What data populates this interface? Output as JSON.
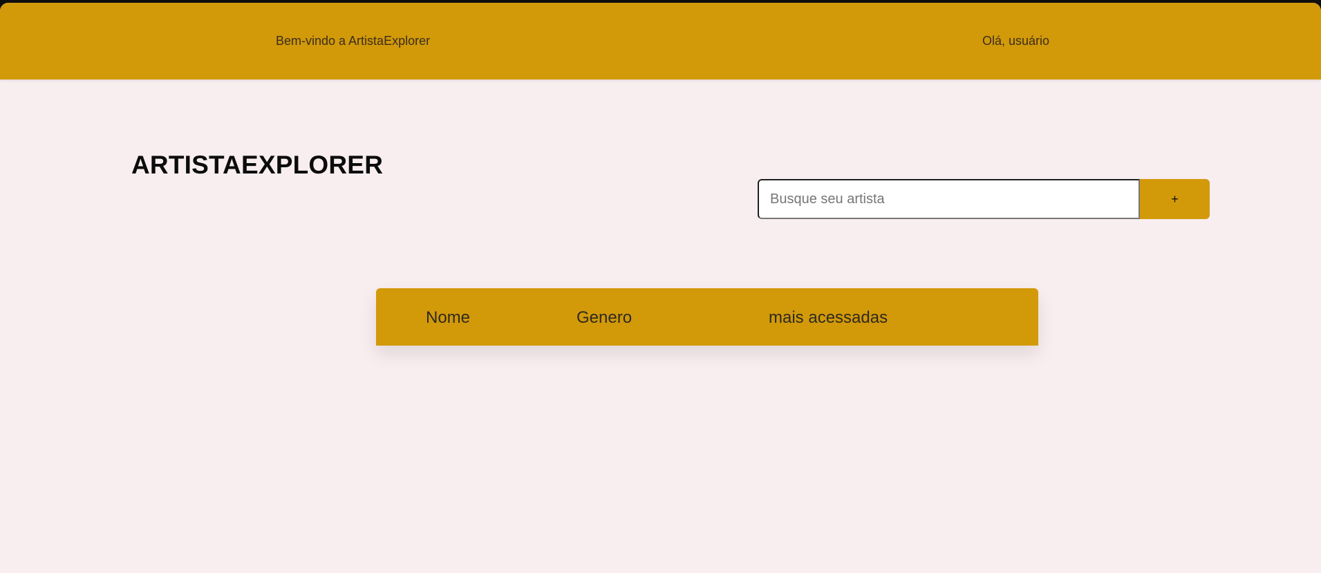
{
  "header": {
    "welcome": "Bem-vindo a ArtistaExplorer",
    "greeting": "Olá, usuário"
  },
  "brand": {
    "title": "ARTISTAEXPLORER"
  },
  "search": {
    "placeholder": "Busque seu artista",
    "value": "",
    "add_label": "+"
  },
  "table": {
    "columns": [
      "Nome",
      "Genero",
      "mais acessadas"
    ],
    "rows": []
  },
  "colors": {
    "accent": "#d29909",
    "background": "#f8eef0"
  }
}
